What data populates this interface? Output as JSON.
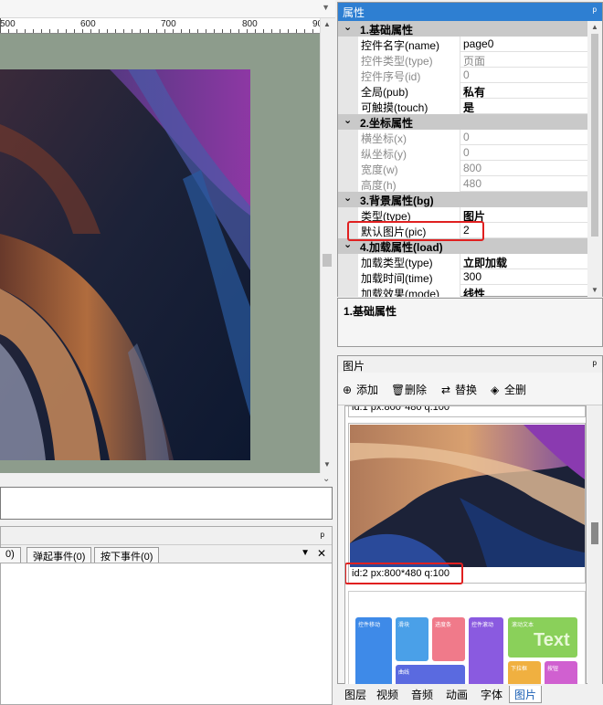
{
  "ruler": {
    "labels": [
      "500",
      "600",
      "700",
      "800",
      "90"
    ]
  },
  "events": {
    "tabs": [
      "0)",
      "弹起事件(0)",
      "按下事件(0)"
    ],
    "pin": "ᵖ",
    "dropdown": "▼",
    "close": "✕"
  },
  "properties": {
    "title": "属性",
    "pin": "ᵖ",
    "sections": [
      {
        "label": "1.基础属性",
        "rows": [
          {
            "k": "控件名字(name)",
            "v": "page0",
            "dis": false,
            "bold": false
          },
          {
            "k": "控件类型(type)",
            "v": "页面",
            "dis": true,
            "bold": false
          },
          {
            "k": "控件序号(id)",
            "v": "0",
            "dis": true,
            "bold": false
          },
          {
            "k": "全局(pub)",
            "v": "私有",
            "dis": false,
            "bold": true
          },
          {
            "k": "可触摸(touch)",
            "v": "是",
            "dis": false,
            "bold": true
          }
        ]
      },
      {
        "label": "2.坐标属性",
        "rows": [
          {
            "k": "横坐标(x)",
            "v": "0",
            "dis": true,
            "bold": false
          },
          {
            "k": "纵坐标(y)",
            "v": "0",
            "dis": true,
            "bold": false
          },
          {
            "k": "宽度(w)",
            "v": "800",
            "dis": true,
            "bold": false
          },
          {
            "k": "高度(h)",
            "v": "480",
            "dis": true,
            "bold": false
          }
        ]
      },
      {
        "label": "3.背景属性(bg)",
        "rows": [
          {
            "k": "类型(type)",
            "v": "图片",
            "dis": false,
            "bold": true
          },
          {
            "k": "默认图片(pic)",
            "v": "2",
            "dis": false,
            "bold": false
          }
        ]
      },
      {
        "label": "4.加载属性(load)",
        "rows": [
          {
            "k": "加载类型(type)",
            "v": "立即加载",
            "dis": false,
            "bold": true
          },
          {
            "k": "加载时间(time)",
            "v": "300",
            "dis": false,
            "bold": false
          },
          {
            "k": "加载效果(mode)",
            "v": "线性",
            "dis": false,
            "bold": true
          }
        ]
      }
    ],
    "description": "1.基础属性"
  },
  "images": {
    "title": "图片",
    "pin": "ᵖ",
    "toolbar": {
      "add": "添加",
      "delete": "删除",
      "replace": "替换",
      "delete_all": "全删"
    },
    "items": [
      {
        "caption": "id:1 px:800*480 q:100"
      },
      {
        "caption": "id:2 px:800*480 q:100"
      }
    ],
    "thumb_texts": [
      "控件移动",
      "滑块",
      "进度条",
      "控件滚动",
      "滚动文本",
      "Text",
      "下拉框",
      "曲线",
      "按钮"
    ]
  },
  "bottom_tabs": [
    "图层",
    "视频",
    "音频",
    "动画",
    "字体",
    "图片"
  ],
  "colors": {
    "accent": "#2e7fd2",
    "highlight": "#e02020",
    "canvas_bg": "#8d9c8c"
  }
}
